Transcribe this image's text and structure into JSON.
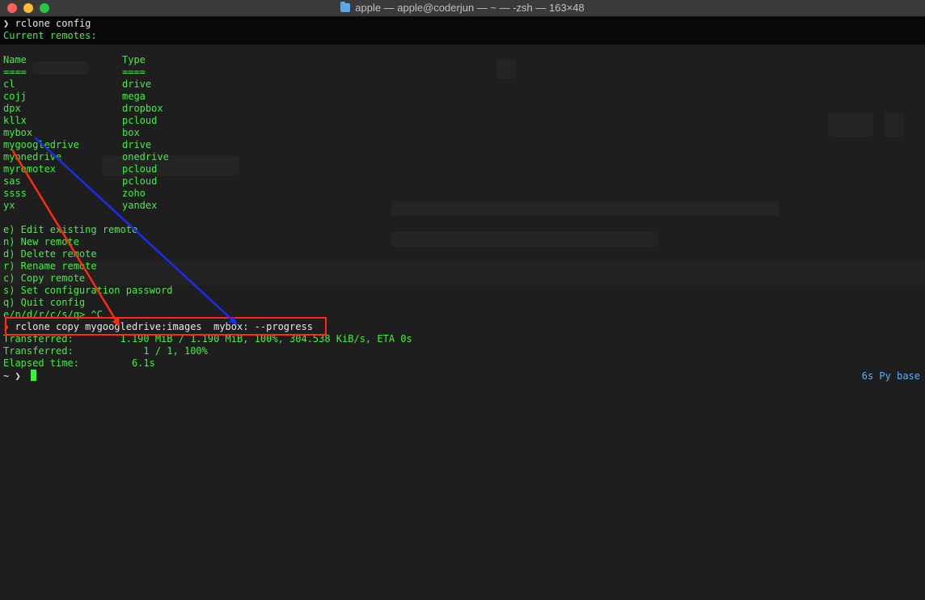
{
  "window": {
    "title": "apple — apple@coderjun — ~ — -zsh — 163×48"
  },
  "terminal": {
    "lines": [
      {
        "prompt": "❯",
        "text": "rclone config"
      },
      {
        "text": "Current remotes:"
      },
      {
        "text": ""
      },
      {
        "col1": "Name",
        "col2": "Type"
      },
      {
        "col1": "====",
        "col2": "===="
      },
      {
        "col1": "cl",
        "col2": "drive"
      },
      {
        "col1": "cojj",
        "col2": "mega"
      },
      {
        "col1": "dpx",
        "col2": "dropbox"
      },
      {
        "col1": "kllx",
        "col2": "pcloud"
      },
      {
        "col1": "mybox",
        "col2": "box"
      },
      {
        "col1": "mygoogledrive",
        "col2": "drive"
      },
      {
        "col1": "myonedrive",
        "col2": "onedrive"
      },
      {
        "col1": "myremotex",
        "col2": "pcloud"
      },
      {
        "col1": "sas",
        "col2": "pcloud"
      },
      {
        "col1": "ssss",
        "col2": "zoho"
      },
      {
        "col1": "yx",
        "col2": "yandex"
      },
      {
        "text": ""
      },
      {
        "text": "e) Edit existing remote"
      },
      {
        "text": "n) New remote"
      },
      {
        "text": "d) Delete remote"
      },
      {
        "text": "r) Rename remote"
      },
      {
        "text": "c) Copy remote"
      },
      {
        "text": "s) Set configuration password"
      },
      {
        "text": "q) Quit config"
      },
      {
        "text": "e/n/d/r/c/s/q> ^C"
      },
      {
        "prompt": "❯",
        "prompt_red": true,
        "text": "rclone copy mygoogledrive:images  mybox: --progress"
      },
      {
        "text": "Transferred:   \t    1.190 MiB / 1.190 MiB, 100%, 304.538 KiB/s, ETA 0s"
      },
      {
        "text": "Transferred:            1 / 1, 100%"
      },
      {
        "text": "Elapsed time:         6.1s"
      },
      {
        "prompt": "~ ❯",
        "cursor": true
      }
    ],
    "right_prompt": "6s Py base"
  },
  "colors": {
    "terminal_green": "#3ff03f",
    "annotation_red": "#ff2a10",
    "annotation_blue": "#1a2cf0"
  }
}
